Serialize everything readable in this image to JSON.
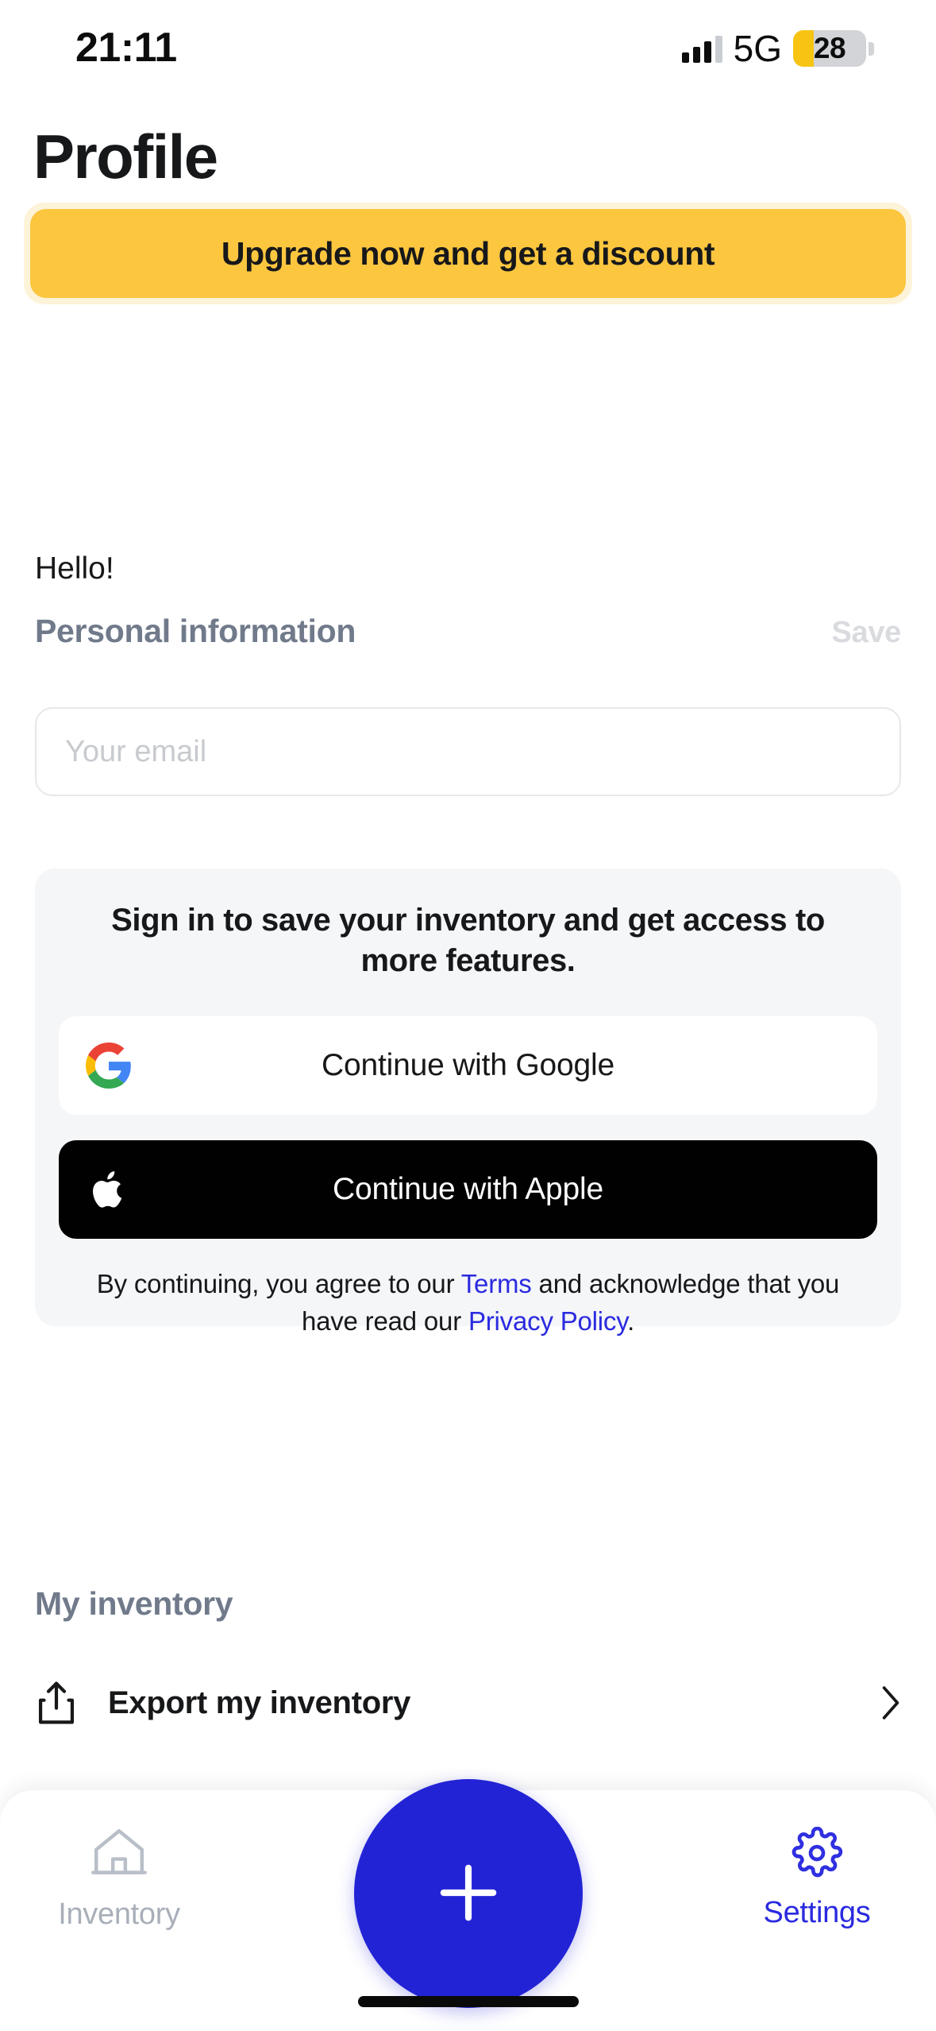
{
  "status_bar": {
    "time": "21:11",
    "network": "5G",
    "battery_level": "28",
    "battery_percent": 28,
    "signal_icon": "cellular-signal-icon",
    "battery_icon": "battery-low-power-icon"
  },
  "header": {
    "title": "Profile"
  },
  "upgrade_banner": {
    "label": "Upgrade now and get a discount"
  },
  "greeting": {
    "text": "Hello!"
  },
  "personal_information": {
    "title": "Personal information",
    "save_label": "Save",
    "email_value": "",
    "email_placeholder": "Your email"
  },
  "signin_card": {
    "heading": "Sign in to save your inventory and get access to more features.",
    "google_label": "Continue with Google",
    "google_icon": "google-logo-icon",
    "apple_label": "Continue with Apple",
    "apple_icon": "apple-logo-icon",
    "legal": {
      "part1": "By continuing, you agree to our ",
      "terms": "Terms",
      "part2": " and acknowledge that you have read our ",
      "privacy": "Privacy Policy",
      "part3": "."
    }
  },
  "my_inventory": {
    "title": "My inventory",
    "export_label": "Export my inventory",
    "export_icon": "share-export-icon",
    "chevron_icon": "chevron-right-icon"
  },
  "tab_bar": {
    "inventory_label": "Inventory",
    "inventory_icon": "home-icon",
    "settings_label": "Settings",
    "settings_icon": "gear-icon",
    "add_icon": "plus-icon"
  },
  "colors": {
    "accent_blue": "#2323d6",
    "banner_yellow": "#fcc63f",
    "banner_yellow_light": "#fdf3d9",
    "link_blue": "#2a2ae0",
    "muted_slate": "#707a8a",
    "card_gray": "#f5f6f8",
    "battery_yellow": "#f7c413"
  }
}
